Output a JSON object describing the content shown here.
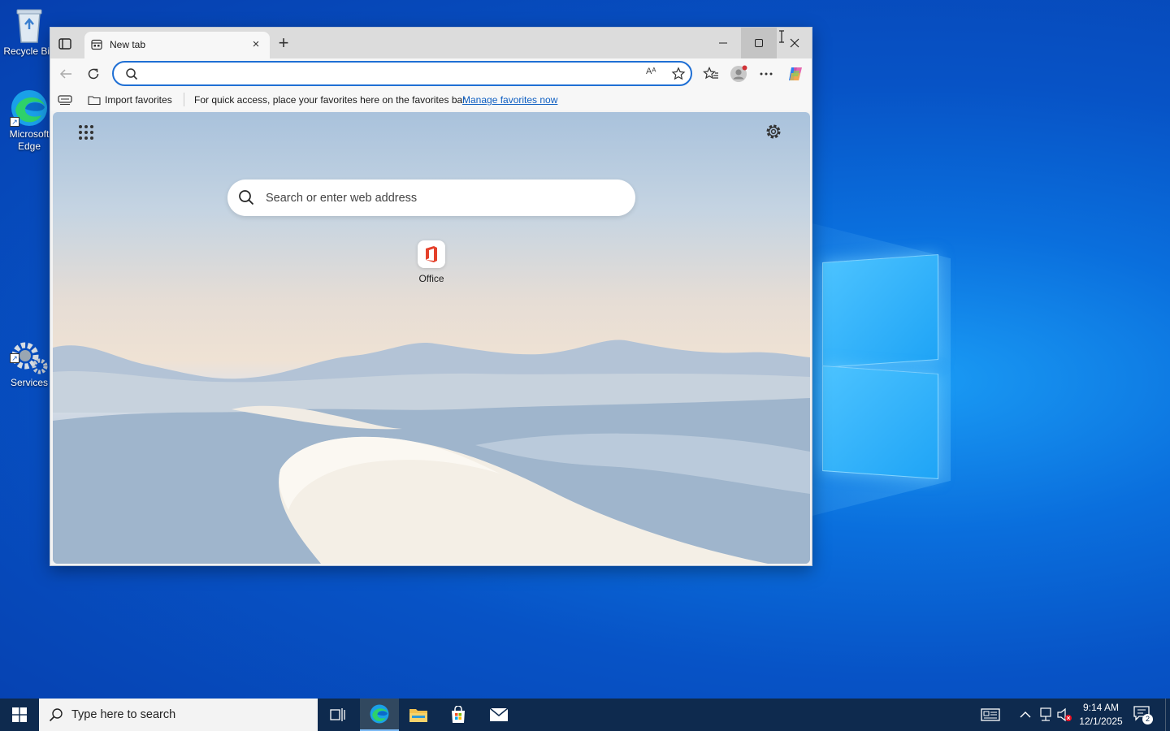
{
  "desktop": {
    "icons": [
      {
        "label": "Recycle Bin",
        "icon": "recycle-bin-icon"
      },
      {
        "label": "Microsoft Edge",
        "icon": "edge-icon"
      },
      {
        "label": "Services",
        "icon": "services-gear-icon"
      }
    ]
  },
  "browser": {
    "tab": {
      "title": "New tab",
      "close": "×"
    },
    "new_tab": "+",
    "address_bar": {
      "value": "",
      "placeholder": ""
    },
    "read_aloud": "Aᴬ",
    "favorites_bar": {
      "import_label": "Import favorites",
      "message": "For quick access, place your favorites here on the favorites bar.",
      "link": "Manage favorites now"
    },
    "new_tab_page": {
      "search_placeholder": "Search or enter web address",
      "quick_links": [
        {
          "label": "Office",
          "icon": "office-icon"
        }
      ]
    }
  },
  "taskbar": {
    "search_placeholder": "Type here to search",
    "clock": {
      "time": "9:14 AM",
      "date": "12/1/2025"
    },
    "notification_count": "2",
    "apps": [
      "task-view-icon",
      "edge-icon",
      "file-explorer-icon",
      "store-icon",
      "mail-icon"
    ]
  },
  "colors": {
    "accent": "#1f6fd4",
    "link": "#0f5fc2",
    "taskbar": "#0e2a4e",
    "desktop": "#0a6fdd"
  }
}
